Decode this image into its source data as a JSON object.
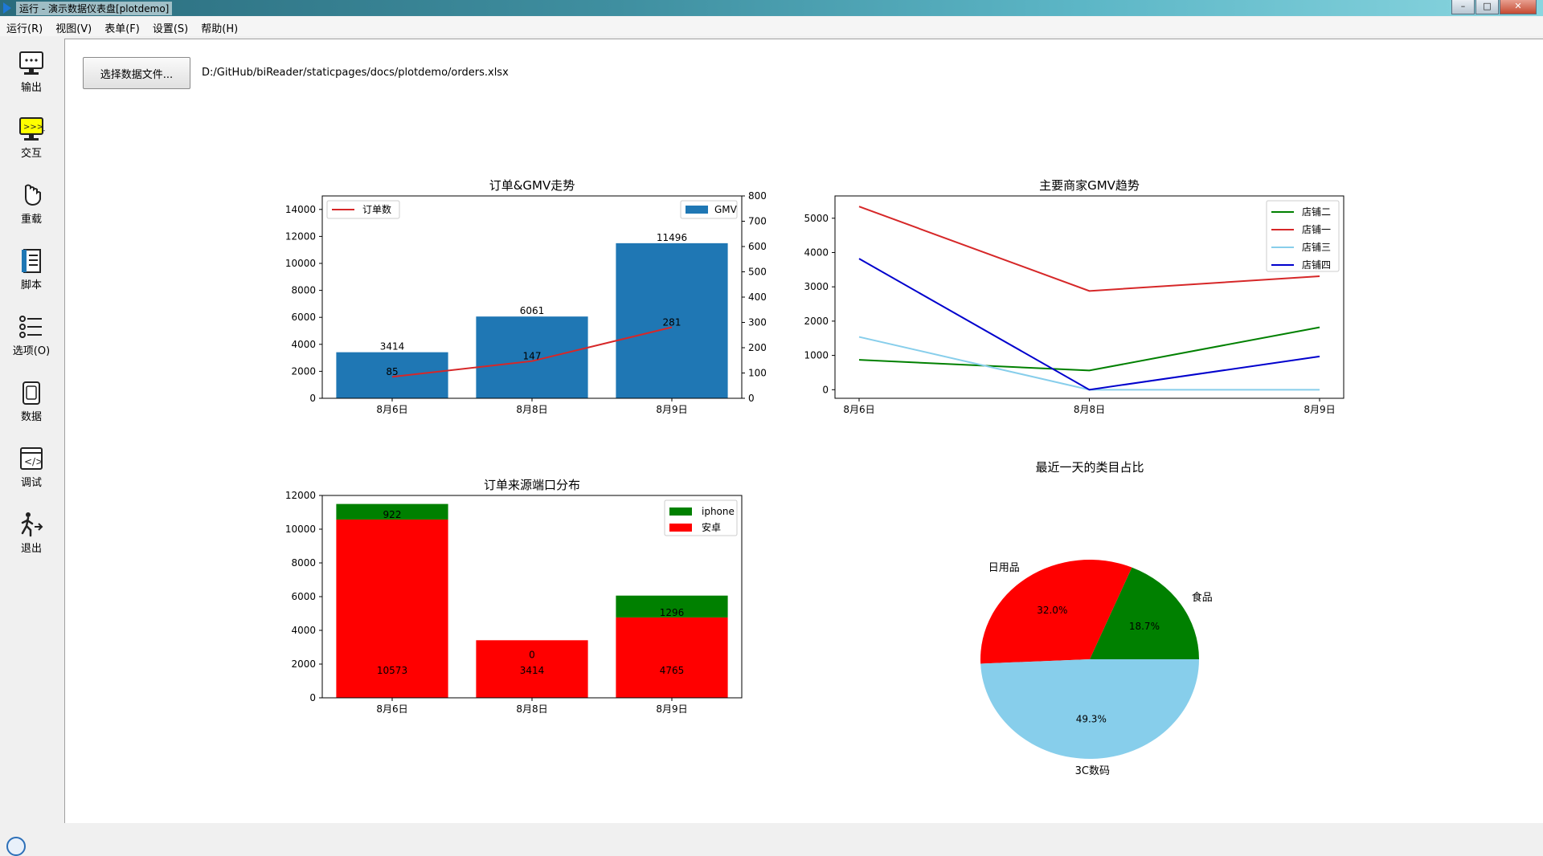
{
  "window": {
    "title": "运行 - 演示数据仪表盘[plotdemo]",
    "min": "–",
    "max": "□",
    "close": "✕"
  },
  "menu": [
    "运行(R)",
    "视图(V)",
    "表单(F)",
    "设置(S)",
    "帮助(H)"
  ],
  "sidebar": [
    {
      "label": "输出",
      "icon": "monitor-icon"
    },
    {
      "label": "交互",
      "icon": "terminal-icon"
    },
    {
      "label": "重载",
      "icon": "reload-hand-icon"
    },
    {
      "label": "脚本",
      "icon": "script-icon"
    },
    {
      "label": "选项(O)",
      "icon": "options-list-icon"
    },
    {
      "label": "数据",
      "icon": "data-icon"
    },
    {
      "label": "调试",
      "icon": "debug-icon"
    },
    {
      "label": "退出",
      "icon": "exit-icon"
    }
  ],
  "toolbar": {
    "pick_label": "选择数据文件...",
    "file_path": "D:/GitHub/biReader/staticpages/docs/plotdemo/orders.xlsx"
  },
  "colors": {
    "bar_blue": "#1f77b4",
    "line_red": "#d62728",
    "green": "#008000",
    "red": "#ff0000",
    "skyblue": "#87ceeb",
    "blue": "#0000cd"
  },
  "chart_data": [
    {
      "type": "bar",
      "title": "订单&GMV走势",
      "categories": [
        "8月6日",
        "8月8日",
        "8月9日"
      ],
      "series": [
        {
          "name": "GMV",
          "type": "bar",
          "axis": "left",
          "values": [
            3414,
            6061,
            11496
          ]
        },
        {
          "name": "订单数",
          "type": "line",
          "axis": "right",
          "values": [
            85,
            147,
            281
          ]
        }
      ],
      "ylim": [
        0,
        15000
      ],
      "yticks": [
        "0",
        "2000",
        "4000",
        "6000",
        "8000",
        "10000",
        "12000",
        "14000"
      ],
      "y2lim": [
        0,
        800
      ],
      "y2ticks": [
        "0",
        "100",
        "200",
        "300",
        "400",
        "500",
        "600",
        "700",
        "800"
      ],
      "legend": [
        "top-left",
        "top-right"
      ]
    },
    {
      "type": "line",
      "title": "主要商家GMV趋势",
      "x": [
        "8月6日",
        "8月8日",
        "8月9日"
      ],
      "series": [
        {
          "name": "店铺二",
          "color": "#008000",
          "values": [
            870,
            560,
            1820
          ]
        },
        {
          "name": "店铺一",
          "color": "#d62728",
          "values": [
            5340,
            2880,
            3310
          ]
        },
        {
          "name": "店铺三",
          "color": "#87ceeb",
          "values": [
            1540,
            0,
            0
          ]
        },
        {
          "name": "店铺四",
          "color": "#0000cd",
          "values": [
            3820,
            0,
            970
          ]
        }
      ],
      "ylim": [
        -250,
        5650
      ],
      "yticks": [
        "0",
        "1000",
        "2000",
        "3000",
        "4000",
        "5000"
      ],
      "legend": "top-right"
    },
    {
      "type": "bar",
      "title": "订单来源端口分布",
      "stacked": true,
      "categories": [
        "8月6日",
        "8月8日",
        "8月9日"
      ],
      "series": [
        {
          "name": "iphone",
          "color": "#008000",
          "values": [
            922,
            0,
            1296
          ]
        },
        {
          "name": "安卓",
          "color": "#ff0000",
          "values": [
            10573,
            3414,
            4765
          ]
        }
      ],
      "ylim": [
        0,
        12000
      ],
      "yticks": [
        "0",
        "2000",
        "4000",
        "6000",
        "8000",
        "10000",
        "12000"
      ],
      "legend": "top-right"
    },
    {
      "type": "pie",
      "title": "最近一天的类目占比",
      "slices": [
        {
          "label": "食品",
          "pct": "18.7%",
          "value": 18.7,
          "color": "#008000"
        },
        {
          "label": "日用品",
          "pct": "32.0%",
          "value": 32.0,
          "color": "#ff0000"
        },
        {
          "label": "3C数码",
          "pct": "49.3%",
          "value": 49.3,
          "color": "#87ceeb"
        }
      ]
    }
  ]
}
